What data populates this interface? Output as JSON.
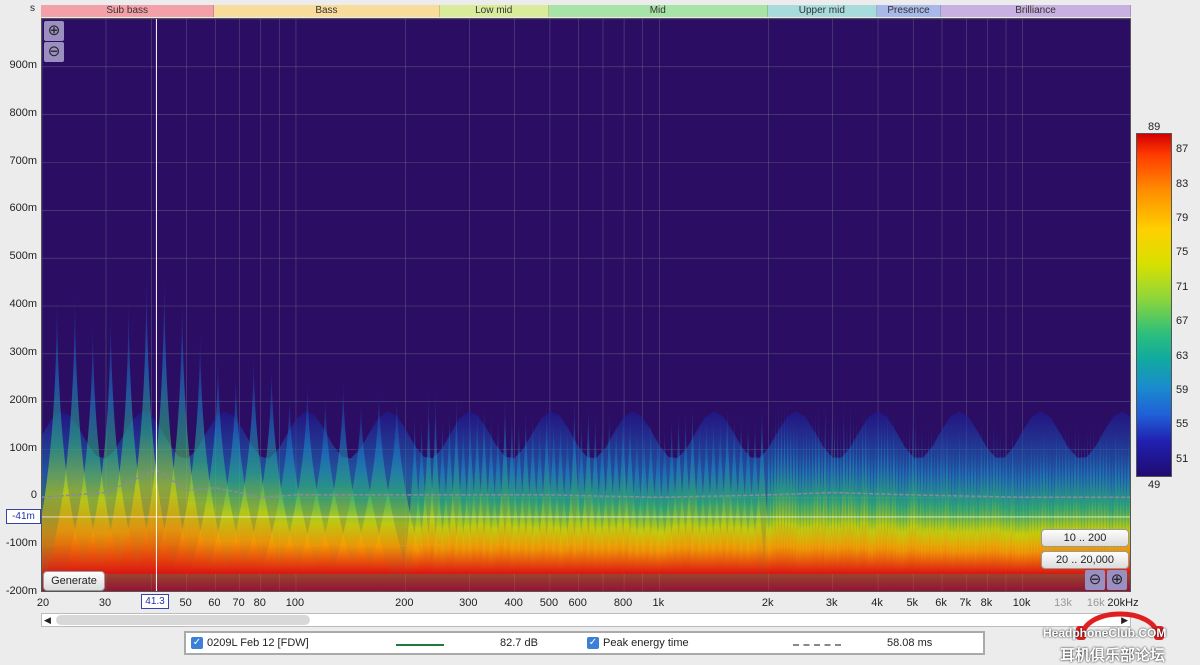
{
  "axis_unit_label": "s",
  "bands": [
    {
      "name": "Sub bass",
      "color": "#f4a0a8"
    },
    {
      "name": "Bass",
      "color": "#f8dc9c"
    },
    {
      "name": "Low mid",
      "color": "#d8ec9c"
    },
    {
      "name": "Mid",
      "color": "#a8e4a8"
    },
    {
      "name": "Upper mid",
      "color": "#a8dcdc"
    },
    {
      "name": "Presence",
      "color": "#a8b8e8"
    },
    {
      "name": "Brilliance",
      "color": "#c8b0e0"
    }
  ],
  "y_ticks": [
    "900m",
    "800m",
    "700m",
    "600m",
    "500m",
    "400m",
    "300m",
    "200m",
    "100m",
    "0",
    "-100m",
    "-200m"
  ],
  "x_ticks": [
    "20",
    "30",
    "50",
    "60",
    "70",
    "80",
    "100",
    "200",
    "300",
    "400",
    "500",
    "600",
    "800",
    "1k",
    "2k",
    "3k",
    "4k",
    "5k",
    "6k",
    "7k",
    "8k",
    "10k",
    "13k",
    "16k",
    "20kHz"
  ],
  "cursor_x": "41.3",
  "cursor_y": "-41m",
  "scale_top": "89",
  "scale_bottom": "49",
  "scale_ticks": [
    "87",
    "83",
    "79",
    "75",
    "71",
    "67",
    "63",
    "59",
    "55",
    "51"
  ],
  "buttons": {
    "generate": "Generate",
    "range_low": "10 .. 200",
    "range_full": "20 .. 20,000",
    "zoom_in": "⊕",
    "zoom_out": "⊖"
  },
  "legend": {
    "measurement_name": "0209L Feb 12 [FDW]",
    "measurement_value": "82.7 dB",
    "peak_label": "Peak energy time",
    "peak_value": "58.08 ms"
  },
  "watermark": {
    "line1": "HeadphoneClub.COM",
    "line2": "耳机俱乐部论坛"
  },
  "chart_data": {
    "type": "heatmap",
    "xlabel": "",
    "ylabel": "",
    "x_scale": "log",
    "xlim": [
      20,
      20000
    ],
    "ylim": [
      -0.2,
      1.0
    ],
    "colorbar_range": [
      49,
      89
    ],
    "peak_energy_time_trace": {
      "x": [
        20,
        30,
        41.3,
        50,
        60,
        70,
        80,
        100,
        200,
        300,
        500,
        1000,
        2000,
        3000,
        5000,
        10000,
        20000
      ],
      "y": [
        0.0,
        0.01,
        0.058,
        0.015,
        0.02,
        0.01,
        0.0,
        0.005,
        0.005,
        0.005,
        0.005,
        0.0,
        0.005,
        0.01,
        0.005,
        0.0,
        0.0
      ]
    },
    "ridge_peaks_s": {
      "x": [
        41.3,
        65,
        80,
        100,
        150,
        250,
        400,
        1000,
        3000,
        10000
      ],
      "y": [
        0.49,
        0.33,
        0.31,
        0.28,
        0.26,
        0.22,
        0.22,
        0.2,
        0.22,
        0.17
      ]
    }
  }
}
